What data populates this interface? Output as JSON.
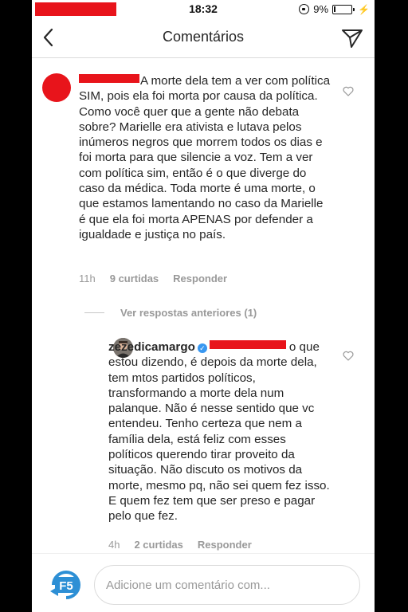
{
  "status_bar": {
    "time": "18:32",
    "battery_percent": "9%",
    "battery_level": 0.09
  },
  "header": {
    "title": "Comentários",
    "back_icon": "chevron-left-icon",
    "send_icon": "paper-plane-icon"
  },
  "comments": [
    {
      "text": "A morte dela tem a ver com política SIM, pois ela foi morta por causa da política. Como você quer que a gente não debata sobre? Marielle era ativista e lutava pelos inúmeros negros que morrem todos os dias e foi morta para que silencie a voz. Tem a ver com política sim, então é o que diverge do caso da médica. Toda morte é uma morte, o que estamos lamentando no caso da Marielle é que ela foi morta APENAS por defender a igualdade e justiça no país.",
      "time": "11h",
      "likes": "9 curtidas",
      "reply": "Responder"
    }
  ],
  "view_previous_replies": "Ver respostas anteriores (1)",
  "reply": {
    "username": "zezedicamargo",
    "text_start": "o que",
    "text": "estou dizendo, é depois da morte dela, tem mtos partidos políticos, transformando a morte dela num palanque. Não é nesse sentido que vc entendeu. Tenho certeza que nem a família dela, está feliz com esses políticos querendo tirar proveito da situação. Não discuto os motivos da morte, mesmo pq, não sei quem fez isso. E quem fez tem que ser preso e pagar pelo que fez.",
    "time": "4h",
    "likes": "2 curtidas",
    "reply": "Responder"
  },
  "footer": {
    "logo": "F5",
    "placeholder": "Adicione um comentário com..."
  },
  "colors": {
    "redaction": "#e8141b",
    "verified": "#3897f0",
    "meta": "#999999",
    "logo": "#2d8fd5"
  }
}
